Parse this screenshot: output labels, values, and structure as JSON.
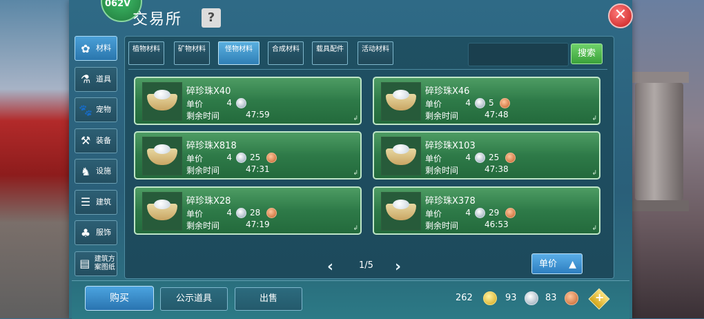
{
  "header": {
    "logo_text": "062V",
    "title": "交易所",
    "help_label": "?",
    "close_label": "✕"
  },
  "sidebar": {
    "items": [
      {
        "label": "材料",
        "icon": "materials-icon",
        "active": true
      },
      {
        "label": "道具",
        "icon": "flask-icon"
      },
      {
        "label": "宠物",
        "icon": "paw-icon"
      },
      {
        "label": "装备",
        "icon": "equipment-icon"
      },
      {
        "label": "设施",
        "icon": "facility-icon"
      },
      {
        "label": "建筑",
        "icon": "building-icon"
      },
      {
        "label": "服饰",
        "icon": "clothing-icon"
      },
      {
        "label": "建筑方案图纸",
        "icon": "blueprint-icon"
      }
    ]
  },
  "tabs": [
    {
      "label": "植物材料"
    },
    {
      "label": "矿物材料"
    },
    {
      "label": "怪物材料",
      "active": true
    },
    {
      "label": "合成材料"
    },
    {
      "label": "载具配件"
    },
    {
      "label": "活动材料"
    }
  ],
  "search": {
    "button_label": "搜索",
    "placeholder": ""
  },
  "cards": [
    {
      "name": "碎珍珠X40",
      "price_label": "单价",
      "silver": "4",
      "copper": "",
      "time_label": "剩余时间",
      "time": "47:59"
    },
    {
      "name": "碎珍珠X46",
      "price_label": "单价",
      "silver": "4",
      "copper": "5",
      "time_label": "剩余时间",
      "time": "47:48"
    },
    {
      "name": "碎珍珠X818",
      "price_label": "单价",
      "silver": "4",
      "copper": "25",
      "time_label": "剩余时间",
      "time": "47:31"
    },
    {
      "name": "碎珍珠X103",
      "price_label": "单价",
      "silver": "4",
      "copper": "25",
      "time_label": "剩余时间",
      "time": "47:38"
    },
    {
      "name": "碎珍珠X28",
      "price_label": "单价",
      "silver": "4",
      "copper": "28",
      "time_label": "剩余时间",
      "time": "47:19"
    },
    {
      "name": "碎珍珠X378",
      "price_label": "单价",
      "silver": "4",
      "copper": "29",
      "time_label": "剩余时间",
      "time": "46:53"
    }
  ],
  "pager": {
    "prev": "‹",
    "next": "›",
    "text": "1/5"
  },
  "sort": {
    "label": "单价",
    "arrow": "▲"
  },
  "bottom": {
    "buy_label": "购买",
    "public_label": "公示道具",
    "sell_label": "出售",
    "gold": "262",
    "silver": "93",
    "copper": "83",
    "add_label": "+"
  },
  "colors": {
    "panel": "#2a5f79",
    "card_green": "#2e7a48",
    "active_blue": "#2f7fb6",
    "search_green": "#3aa13a",
    "close_red": "#c61c1c"
  }
}
